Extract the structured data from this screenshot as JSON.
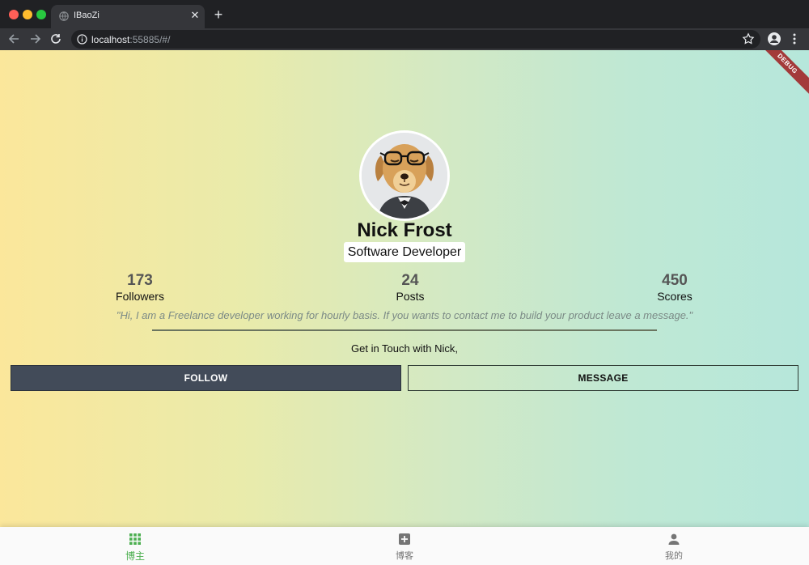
{
  "browser": {
    "tab_title": "IBaoZi",
    "url_host": "localhost",
    "url_rest": ":55885/#/"
  },
  "debug_banner": "DEBUG",
  "profile": {
    "name": "Nick Frost",
    "role": "Software Developer",
    "avatar_icon": "dog-with-glasses-avatar"
  },
  "stats": [
    {
      "value": "173",
      "label": "Followers"
    },
    {
      "value": "24",
      "label": "Posts"
    },
    {
      "value": "450",
      "label": "Scores"
    }
  ],
  "bio": "\"Hi, I am a Freelance developer working for hourly basis. If you wants to contact me to build your product leave a message.\"",
  "contact_prompt": "Get in Touch with Nick,",
  "buttons": {
    "follow": "FOLLOW",
    "message": "MESSAGE"
  },
  "bottom_nav": [
    {
      "label": "博主",
      "icon": "apps-grid-icon",
      "active": true
    },
    {
      "label": "博客",
      "icon": "add-box-icon",
      "active": false
    },
    {
      "label": "我的",
      "icon": "person-icon",
      "active": false
    }
  ],
  "colors": {
    "accent": "#4caf50",
    "follow_button": "#424b59",
    "gradient_left": "#fbe79b",
    "gradient_right": "#b6e7db"
  }
}
